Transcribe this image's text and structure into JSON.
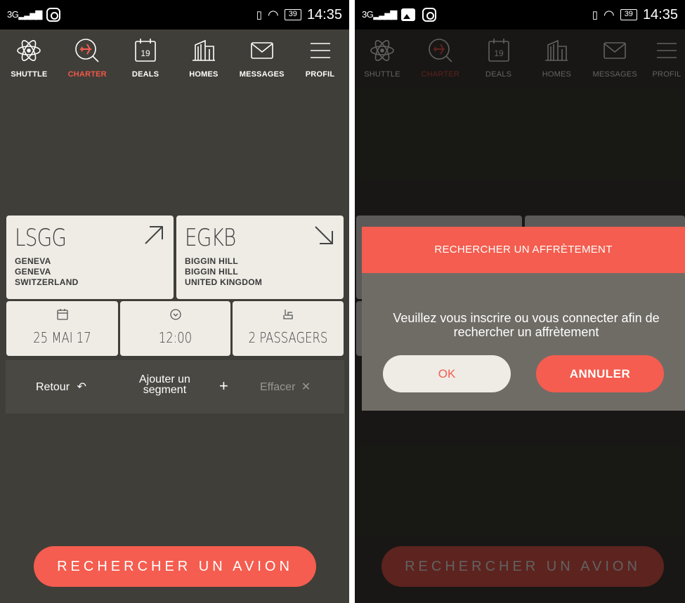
{
  "status_bar": {
    "signal": "3G",
    "battery": "39",
    "time": "14:35"
  },
  "nav": [
    {
      "label": "SHUTTLE",
      "icon": "atom-icon"
    },
    {
      "label": "CHARTER",
      "icon": "plane-search-icon",
      "active": true
    },
    {
      "label": "DEALS",
      "icon": "calendar-19-icon"
    },
    {
      "label": "HOMES",
      "icon": "building-icon"
    },
    {
      "label": "MESSAGES",
      "icon": "envelope-icon"
    },
    {
      "label": "PROFIL",
      "icon": "menu-icon"
    }
  ],
  "calendar_icon_day": "19",
  "departure": {
    "code": "LSGG",
    "lines": [
      "GENEVA",
      "GENEVA",
      "SWITZERLAND"
    ]
  },
  "arrival": {
    "code": "EGKB",
    "lines": [
      "BIGGIN HILL",
      "BIGGIN HILL",
      "UNITED KINGDOM"
    ]
  },
  "date": "25 MAI 17",
  "time": "12:00",
  "passengers": "2 PASSAGERS",
  "actions": {
    "back": "Retour",
    "add_segment_1": "Ajouter un",
    "add_segment_2": "segment",
    "clear": "Effacer"
  },
  "search_button": "RECHERCHER UN AVION",
  "dialog": {
    "title": "RECHERCHER UN AFFRÈTEMENT",
    "message": "Veuillez vous inscrire ou vous connecter afin de rechercher un affrètement",
    "ok": "OK",
    "cancel": "ANNULER"
  },
  "colors": {
    "accent": "#f45d4f",
    "background": "#403e38",
    "card": "#efece6"
  }
}
